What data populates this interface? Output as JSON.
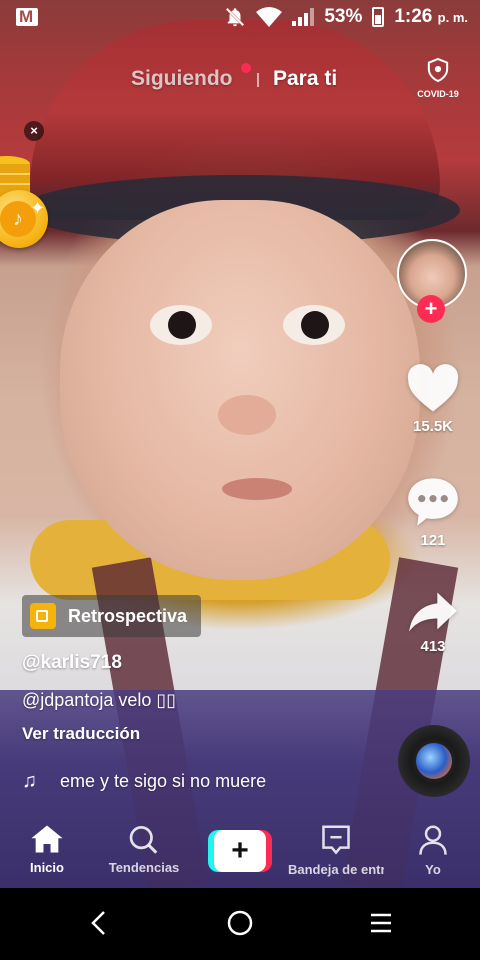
{
  "status_bar": {
    "battery": "53%",
    "time": "1:26",
    "ampm": "p. m.",
    "icons": [
      "gmail-icon",
      "mute-icon",
      "wifi-icon",
      "signal-icon",
      "battery-icon"
    ]
  },
  "top_tabs": {
    "following": "Siguiendo",
    "for_you": "Para ti",
    "covid_label": "COVID-19"
  },
  "coin_widget": {
    "close": "×",
    "coin_mark": "♪"
  },
  "rail": {
    "likes": "15.5K",
    "comments": "121",
    "shares": "413",
    "follow_plus": "+"
  },
  "video_info": {
    "effect_label": "Retrospectiva",
    "username": "@karlis718",
    "caption": "@jdpantoja velo ▯▯",
    "translate": "Ver traducción",
    "music_note": "♫",
    "music": "eme y te sigo si no muere"
  },
  "bottom_nav": {
    "home": "Inicio",
    "discover": "Tendencias",
    "create": "+",
    "inbox": "Bandeja de entrada",
    "me": "Yo"
  },
  "colors": {
    "accent": "#fe2c55",
    "cyan": "#25f4ee",
    "coin": "#f5b10f"
  }
}
